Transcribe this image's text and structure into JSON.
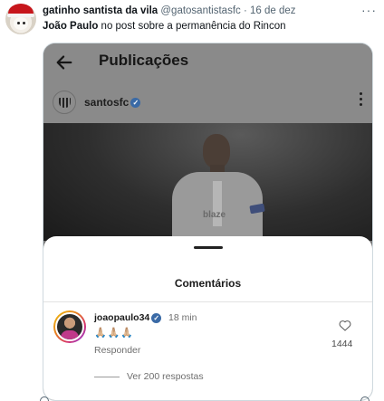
{
  "tweet": {
    "display_name": "gatinho santista da vila",
    "handle": "@gatosantistasfc",
    "separator": "·",
    "date": "16 de dez",
    "more_icon": "more-horizontal-icon",
    "text_bold": "João Paulo",
    "text_rest": " no post sobre a permanência do Rincon"
  },
  "instagram": {
    "screen_title": "Publicações",
    "back_icon": "arrow-left-icon",
    "post_username": "santosfc",
    "photo_sponsor": "blaze",
    "comments_sheet": {
      "title": "Comentários",
      "comment": {
        "username": "joaopaulo34",
        "time": "18 min",
        "text": "🙏🏼🙏🏼🙏🏼",
        "reply_label": "Responder",
        "like_count": "1444"
      },
      "view_replies": "Ver 200 respostas"
    }
  },
  "colors": {
    "instagram_dim": "#8a8a8a",
    "verified_blue": "#3a6aa6",
    "twitter_gray": "#536471"
  }
}
